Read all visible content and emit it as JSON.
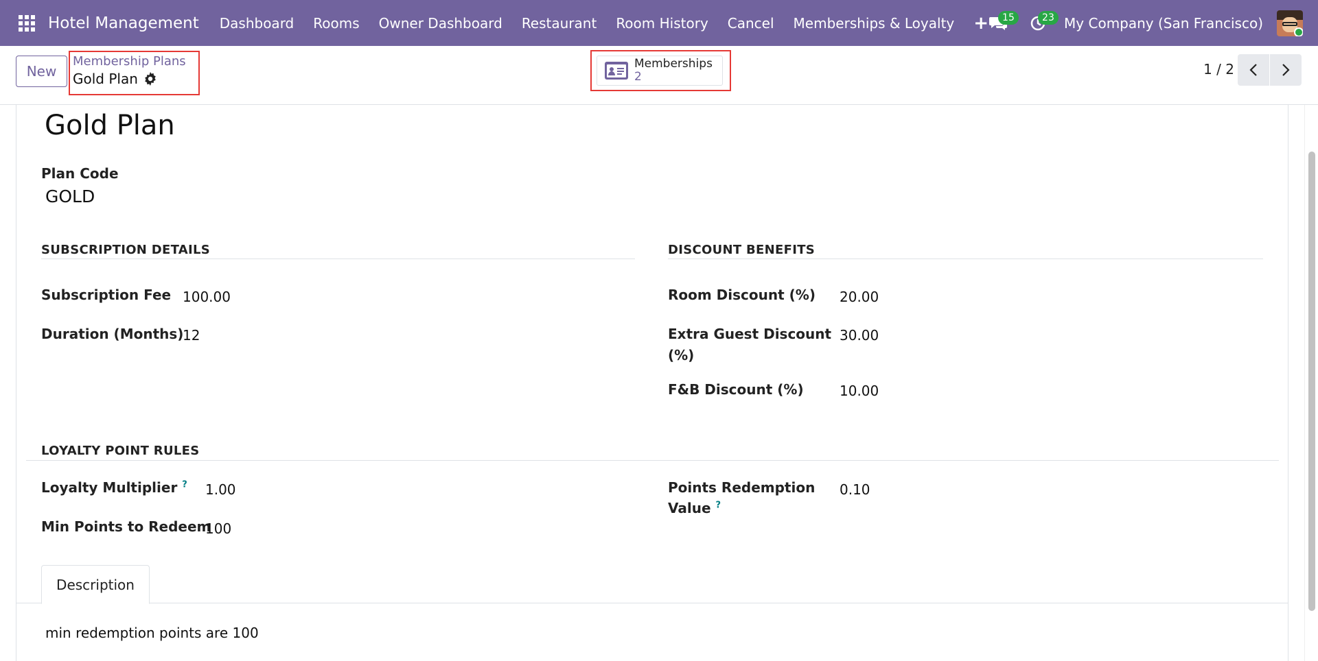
{
  "navbar": {
    "app_name": "Hotel Management",
    "menu": [
      "Dashboard",
      "Rooms",
      "Owner Dashboard",
      "Restaurant",
      "Room History",
      "Cancel",
      "Memberships & Loyalty"
    ],
    "plus_label": "+",
    "messages_count": "15",
    "activities_count": "23",
    "company": "My Company (San Francisco)"
  },
  "control_panel": {
    "new_label": "New",
    "breadcrumb_parent": "Membership Plans",
    "breadcrumb_current": "Gold Plan",
    "smart_button": {
      "label": "Memberships",
      "value": "2"
    },
    "pager": "1 / 2"
  },
  "form": {
    "title": "Gold Plan",
    "plan_code_label": "Plan Code",
    "plan_code_value": "GOLD",
    "subscription": {
      "heading": "SUBSCRIPTION DETAILS",
      "fee_label": "Subscription Fee",
      "fee_value": "100.00",
      "duration_label": "Duration (Months)",
      "duration_value": "12"
    },
    "discounts": {
      "heading": "DISCOUNT BENEFITS",
      "room_label": "Room Discount (%)",
      "room_value": "20.00",
      "extra_guest_label_line1": "Extra Guest Discount",
      "extra_guest_label_line2": "(%)",
      "extra_guest_value": "30.00",
      "fnb_label": "F&B Discount (%)",
      "fnb_value": "10.00"
    },
    "loyalty": {
      "heading": "LOYALTY POINT RULES",
      "multiplier_label": "Loyalty Multiplier",
      "multiplier_value": "1.00",
      "min_points_label": "Min Points to Redeem",
      "min_points_value": "100",
      "redemption_label_line1": "Points Redemption",
      "redemption_label_line2": "Value",
      "redemption_value": "0.10",
      "help_mark": "?"
    },
    "tabs": {
      "description_label": "Description"
    },
    "description_text": "min redemption points are 100"
  }
}
